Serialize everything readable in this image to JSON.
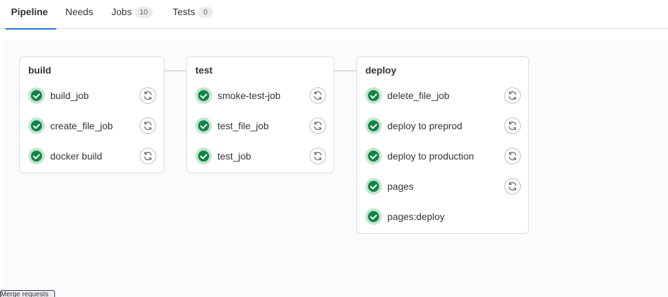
{
  "tabs": [
    {
      "label": "Pipeline",
      "active": true
    },
    {
      "label": "Needs"
    },
    {
      "label": "Jobs",
      "count": "10"
    },
    {
      "label": "Tests",
      "count": "0"
    }
  ],
  "stages": [
    {
      "name": "build",
      "jobs": [
        {
          "name": "build_job",
          "status": "passed",
          "retry": true
        },
        {
          "name": "create_file_job",
          "status": "passed",
          "retry": true
        },
        {
          "name": "docker build",
          "status": "passed",
          "retry": true
        }
      ]
    },
    {
      "name": "test",
      "jobs": [
        {
          "name": "smoke-test-job",
          "status": "passed",
          "retry": true
        },
        {
          "name": "test_file_job",
          "status": "passed",
          "retry": true
        },
        {
          "name": "test_job",
          "status": "passed",
          "retry": true
        }
      ]
    },
    {
      "name": "deploy",
      "jobs": [
        {
          "name": "delete_file_job",
          "status": "passed",
          "retry": true
        },
        {
          "name": "deploy to preprod",
          "status": "passed",
          "retry": true
        },
        {
          "name": "deploy to production",
          "status": "passed",
          "retry": true
        },
        {
          "name": "pages",
          "status": "passed",
          "retry": true
        },
        {
          "name": "pages:deploy",
          "status": "passed",
          "retry": false
        }
      ]
    }
  ],
  "tooltip": "Merge requests",
  "colors": {
    "accent": "#1f75cb",
    "success": "#108548"
  },
  "icons": {
    "status": "status-success-icon",
    "retry": "retry-icon"
  }
}
